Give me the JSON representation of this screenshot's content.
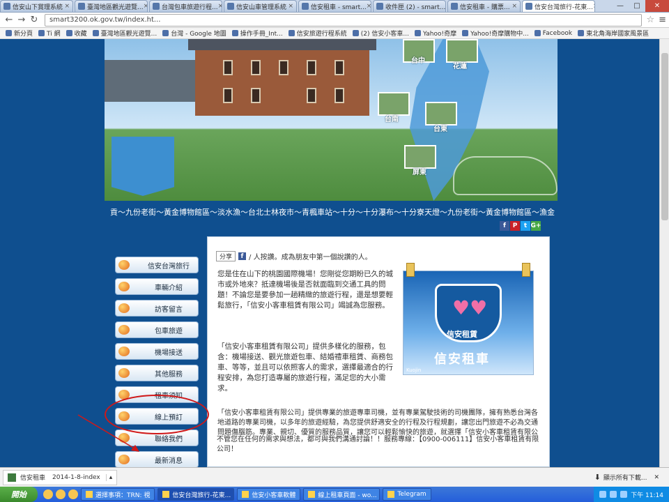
{
  "browser": {
    "tabs": [
      {
        "label": "信安山下賞理系統",
        "active": false
      },
      {
        "label": "臺灣地區觀光遊覽...",
        "active": false
      },
      {
        "label": "台灣包車旅遊行程...",
        "active": false
      },
      {
        "label": "信安山車管理系統",
        "active": false
      },
      {
        "label": "信安租車 - smart...",
        "active": false
      },
      {
        "label": "收件匣 (2) - smart...",
        "active": false
      },
      {
        "label": "信安租車 - 購票...",
        "active": false
      },
      {
        "label": "信安台灣旅行-花東...",
        "active": true
      }
    ],
    "url": "smart3200.ok.gov.tw/index.ht...",
    "window_controls": {
      "minimize": "—",
      "maximize": "□",
      "close": "✕"
    },
    "bookmarks": [
      "新分頁",
      "Ti 網",
      "收藏",
      "臺灣地區觀光遊覽...",
      "台灣 - Google 地圖",
      "操作手冊_Int...",
      "信安旅遊行程系統",
      "(2) 信安小客車...",
      "Yahoo!奇摩",
      "Yahoo!奇摩購物中...",
      "Facebook",
      "東北角海岸國家風景區"
    ]
  },
  "banner": {
    "cities": [
      {
        "id": "taichung",
        "label": "台中"
      },
      {
        "id": "hualien",
        "label": "花蓮"
      },
      {
        "id": "tainan",
        "label": "台南"
      },
      {
        "id": "taitung",
        "label": "台東"
      },
      {
        "id": "pingtung",
        "label": "屏東"
      }
    ],
    "marquee": "貢～九份老街～黃金博物館區～淡水漁～台北士林夜市～青楓車站～十分～十分瀑布～十分寮天燈～九份老街～黃金博物館區～漁金"
  },
  "social": [
    "f",
    "P",
    "t",
    "G+"
  ],
  "menu": [
    {
      "id": "about",
      "label": "信安台灣旅行"
    },
    {
      "id": "car-intro",
      "label": "車輛介紹"
    },
    {
      "id": "guestbook",
      "label": "訪客留言"
    },
    {
      "id": "package",
      "label": "包車旅遊"
    },
    {
      "id": "airport",
      "label": "機場接送"
    },
    {
      "id": "other",
      "label": "其他服務"
    },
    {
      "id": "rent",
      "label": "租車須知"
    },
    {
      "id": "online",
      "label": "線上預訂"
    },
    {
      "id": "contact",
      "label": "聯絡我們"
    },
    {
      "id": "news",
      "label": "最新消息"
    }
  ],
  "content": {
    "share_label": "分享",
    "share_text": "/ 人按讚。成為朋友中第一個說讚的人。",
    "paragraphs": [
      "您是住在山下的桃園國際機場！您剛從您期盼已久的城市或外地來？抵達機場後是否就面臨到交通工具的問題！不論您是要參加一趟精緻的旅遊行程，還是想要輕鬆旅行，「信安小客車租賃有限公司」竭誠為您服務。",
      "「信安小客車租賃有限公司」提供多樣化的服務，包含：機場接送、觀光旅遊包車、結婚禮車租賃、商務包車、等等，並且可以依照客人的需求，選擇最適合的行程安排，為您打造專屬的旅遊行程，滿足您的大小需求。",
      "「信安小客車租賃有限公司」提供專業的旅遊專車司機，並有專業駕駛技術的司機團隊，擁有熟悉台灣各地道路的專業司機，以多年的旅遊經驗，為您提供舒適安全的行程及行程規劃，讓您出門旅遊不必為交通問題傷腦筋。專業、親切、優質的服務品質，讓您可以輕鬆愉快的旅遊，就選擇「信安小客車租賃有限公司」。",
      "不管您在任何的需求與想法，都可與我們溝通討論！！服務專線：【0900-006111】信安小客車租賃有限公司！"
    ],
    "logo": {
      "sub": "信安租賃",
      "big": "信安租車",
      "sig": "Kuojin"
    }
  },
  "downloads": {
    "item_name": "信安租車",
    "item_meta": "2014-1-8-index",
    "show_all": "顯示所有下載...",
    "close": "✕"
  },
  "taskbar": {
    "start": "開始",
    "tasks": [
      {
        "label": "選擇事項：TRN: 視",
        "active": false
      },
      {
        "label": "信安台灣旅行-花東...",
        "active": true
      },
      {
        "label": "信安小客車軟體",
        "active": false
      },
      {
        "label": "線上租車頁面 - wo...",
        "active": false
      },
      {
        "label": "Telegram",
        "active": false
      }
    ],
    "clock": "下午 11:14"
  },
  "colors": {
    "page_bg": "#0f4f8f",
    "annotation": "#d01818"
  }
}
